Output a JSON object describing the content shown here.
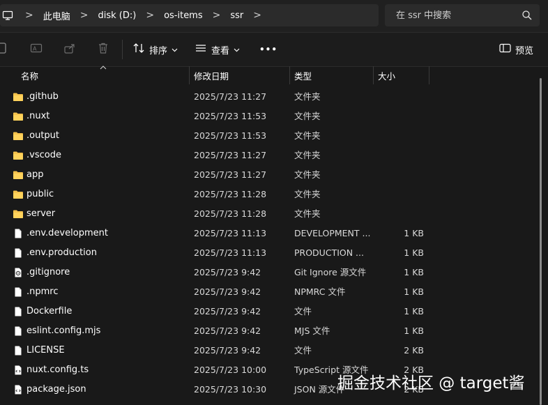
{
  "address": {
    "crumbs": [
      "此电脑",
      "disk (D:)",
      "os-items",
      "ssr"
    ],
    "separator": ">"
  },
  "search": {
    "placeholder": "在 ssr 中搜索"
  },
  "toolbar": {
    "sort_label": "排序",
    "view_label": "查看",
    "more_label": "•••",
    "preview_label": "预览"
  },
  "columns": {
    "name": "名称",
    "date": "修改日期",
    "type": "类型",
    "size": "大小"
  },
  "files": [
    {
      "name": ".github",
      "date": "2025/7/23 11:27",
      "type": "文件夹",
      "size": "",
      "icon": "folder-icon"
    },
    {
      "name": ".nuxt",
      "date": "2025/7/23 11:53",
      "type": "文件夹",
      "size": "",
      "icon": "folder-icon"
    },
    {
      "name": ".output",
      "date": "2025/7/23 11:53",
      "type": "文件夹",
      "size": "",
      "icon": "folder-icon"
    },
    {
      "name": ".vscode",
      "date": "2025/7/23 11:27",
      "type": "文件夹",
      "size": "",
      "icon": "folder-icon"
    },
    {
      "name": "app",
      "date": "2025/7/23 11:27",
      "type": "文件夹",
      "size": "",
      "icon": "folder-icon"
    },
    {
      "name": "public",
      "date": "2025/7/23 11:28",
      "type": "文件夹",
      "size": "",
      "icon": "folder-icon"
    },
    {
      "name": "server",
      "date": "2025/7/23 11:28",
      "type": "文件夹",
      "size": "",
      "icon": "folder-icon"
    },
    {
      "name": ".env.development",
      "date": "2025/7/23 11:13",
      "type": "DEVELOPMENT ...",
      "size": "1 KB",
      "icon": "file-icon"
    },
    {
      "name": ".env.production",
      "date": "2025/7/23 11:13",
      "type": "PRODUCTION ...",
      "size": "1 KB",
      "icon": "file-icon"
    },
    {
      "name": ".gitignore",
      "date": "2025/7/23 9:42",
      "type": "Git Ignore 源文件",
      "size": "1 KB",
      "icon": "gear-file-icon"
    },
    {
      "name": ".npmrc",
      "date": "2025/7/23 9:42",
      "type": "NPMRC 文件",
      "size": "1 KB",
      "icon": "file-icon"
    },
    {
      "name": "Dockerfile",
      "date": "2025/7/23 9:42",
      "type": "文件",
      "size": "1 KB",
      "icon": "file-icon"
    },
    {
      "name": "eslint.config.mjs",
      "date": "2025/7/23 9:42",
      "type": "MJS 文件",
      "size": "1 KB",
      "icon": "file-icon"
    },
    {
      "name": "LICENSE",
      "date": "2025/7/23 9:42",
      "type": "文件",
      "size": "2 KB",
      "icon": "file-icon"
    },
    {
      "name": "nuxt.config.ts",
      "date": "2025/7/23 10:00",
      "type": "TypeScript 源文件",
      "size": "2 KB",
      "icon": "code-file-icon"
    },
    {
      "name": "package.json",
      "date": "2025/7/23 10:30",
      "type": "JSON 源文件",
      "size": "2 KB",
      "icon": "code-file-icon"
    }
  ],
  "watermark": "掘金技术社区 @ target酱",
  "colors": {
    "background": "#191919",
    "folder": "#f5c24c",
    "text": "#ffffff"
  }
}
